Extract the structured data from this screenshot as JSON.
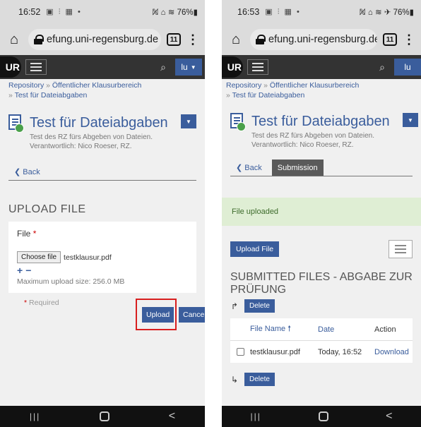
{
  "left": {
    "status": {
      "time": "16:52",
      "icons": "▣ ⫶ ▦ •",
      "right": "ℕ̸ ⌂ ≋ 76%▮"
    },
    "browser": {
      "url": "efung.uni-regensburg.de",
      "tab_count": "11"
    },
    "appbar": {
      "logo": "UR",
      "user": "lu"
    },
    "breadcrumb": {
      "repo": "Repository",
      "sep": "»",
      "area": "Öffentlicher Klausurbereich",
      "item": "Test für Dateiabgaben"
    },
    "title": "Test für Dateiabgaben",
    "desc": "Test des RZ fürs Abgeben von Dateien.",
    "responsible": "Verantwortlich: Nico Roeser, RZ.",
    "back": "Back",
    "upload_heading": "UPLOAD FILE",
    "form": {
      "file_label": "File",
      "required_star": "*",
      "choose_btn": "Choose file",
      "file_name": "testklausur.pdf",
      "plus": "+",
      "minus": "−",
      "max_size": "Maximum upload size: 256.0 MB"
    },
    "required_note": "Required",
    "upload_btn": "Upload",
    "cancel_btn": "Cancel",
    "highlight_color": "#d81f1f"
  },
  "right": {
    "status": {
      "time": "16:53",
      "icons": "▣ ⫶ ▦ •",
      "right": "ℕ̸ ⌂ ≋ ✈ 76%▮"
    },
    "browser": {
      "url": "efung.uni-regensburg.de",
      "tab_count": "11"
    },
    "appbar": {
      "logo": "UR",
      "user": "lu"
    },
    "breadcrumb": {
      "repo": "Repository",
      "sep": "»",
      "area": "Öffentlicher Klausurbereich",
      "item": "Test für Dateiabgaben"
    },
    "title": "Test für Dateiabgaben",
    "desc": "Test des RZ fürs Abgeben von Dateien.",
    "responsible": "Verantwortlich: Nico Roeser, RZ.",
    "back": "Back",
    "submission_tab": "Submission",
    "alert": "File uploaded",
    "upload_file_btn": "Upload File",
    "submitted_heading": "SUBMITTED FILES - ABGABE ZUR PRÜFUNG",
    "delete_btn": "Delete",
    "table": {
      "headers": {
        "name": "File Name",
        "date": "Date",
        "action": "Action"
      },
      "rows": [
        {
          "name": "testklausur.pdf",
          "date": "Today, 16:52",
          "action": "Download"
        }
      ]
    }
  },
  "accent_color": "#3a5d9c"
}
